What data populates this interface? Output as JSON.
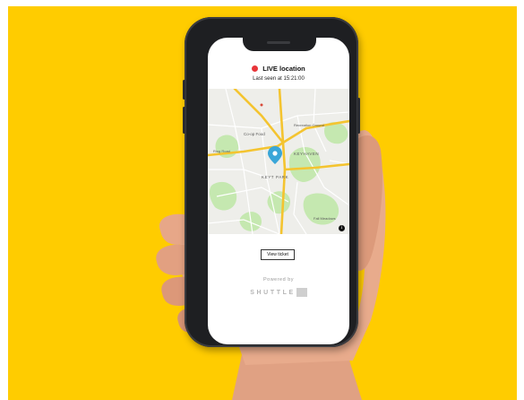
{
  "colors": {
    "background": "#ffcc00",
    "live_dot": "#e8353a",
    "phone_frame": "#1e1f22",
    "map_road": "#f4c430",
    "map_park": "#c5e8b0",
    "pin": "#3aa6d8"
  },
  "live": {
    "label": "LIVE location",
    "status_icon": "red-dot-icon"
  },
  "last_seen": "Last seen at 15:21:00",
  "map": {
    "labels": {
      "coop": "Co-op Food",
      "park": "KEYT PARK",
      "ring_road": "Ring Road",
      "area_right": "KEYHAVEN",
      "fields": "Recreation Ground",
      "fall": "Fall Meadows"
    },
    "info_icon": "i"
  },
  "actions": {
    "view_ticket": "View ticket"
  },
  "footer": {
    "powered_by": "Powered by",
    "brand": "SHUTTLE"
  }
}
